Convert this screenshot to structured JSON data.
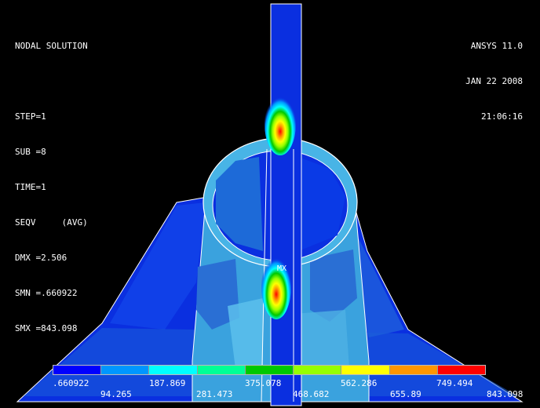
{
  "header": {
    "lines": [
      "NODAL SOLUTION",
      "",
      "STEP=1",
      "SUB =8",
      "TIME=1",
      "SEQV     (AVG)",
      "DMX =2.506",
      "SMN =.660922",
      "SMX =843.098"
    ]
  },
  "stamp": {
    "product": "ANSYS 11.0",
    "date": "JAN 22 2008",
    "time": "21:06:16"
  },
  "markers": {
    "max_label": "MX"
  },
  "legend": {
    "colors": [
      "#0000ff",
      "#0096ff",
      "#00ffff",
      "#00ff96",
      "#00c800",
      "#96ff00",
      "#ffff00",
      "#ff9600",
      "#ff0000"
    ],
    "values_row1": [
      ".660922",
      "187.869",
      "375.078",
      "562.286",
      "749.494"
    ],
    "values_row2": [
      "94.265",
      "281.473",
      "468.682",
      "655.89",
      "843.098"
    ]
  },
  "palette": {
    "background": "#000000",
    "body_blue": "#0a2fe0",
    "shade_blue": "#1f6fd8",
    "light_cyan": "#48b4e6",
    "edge_white": "#ffffff"
  }
}
